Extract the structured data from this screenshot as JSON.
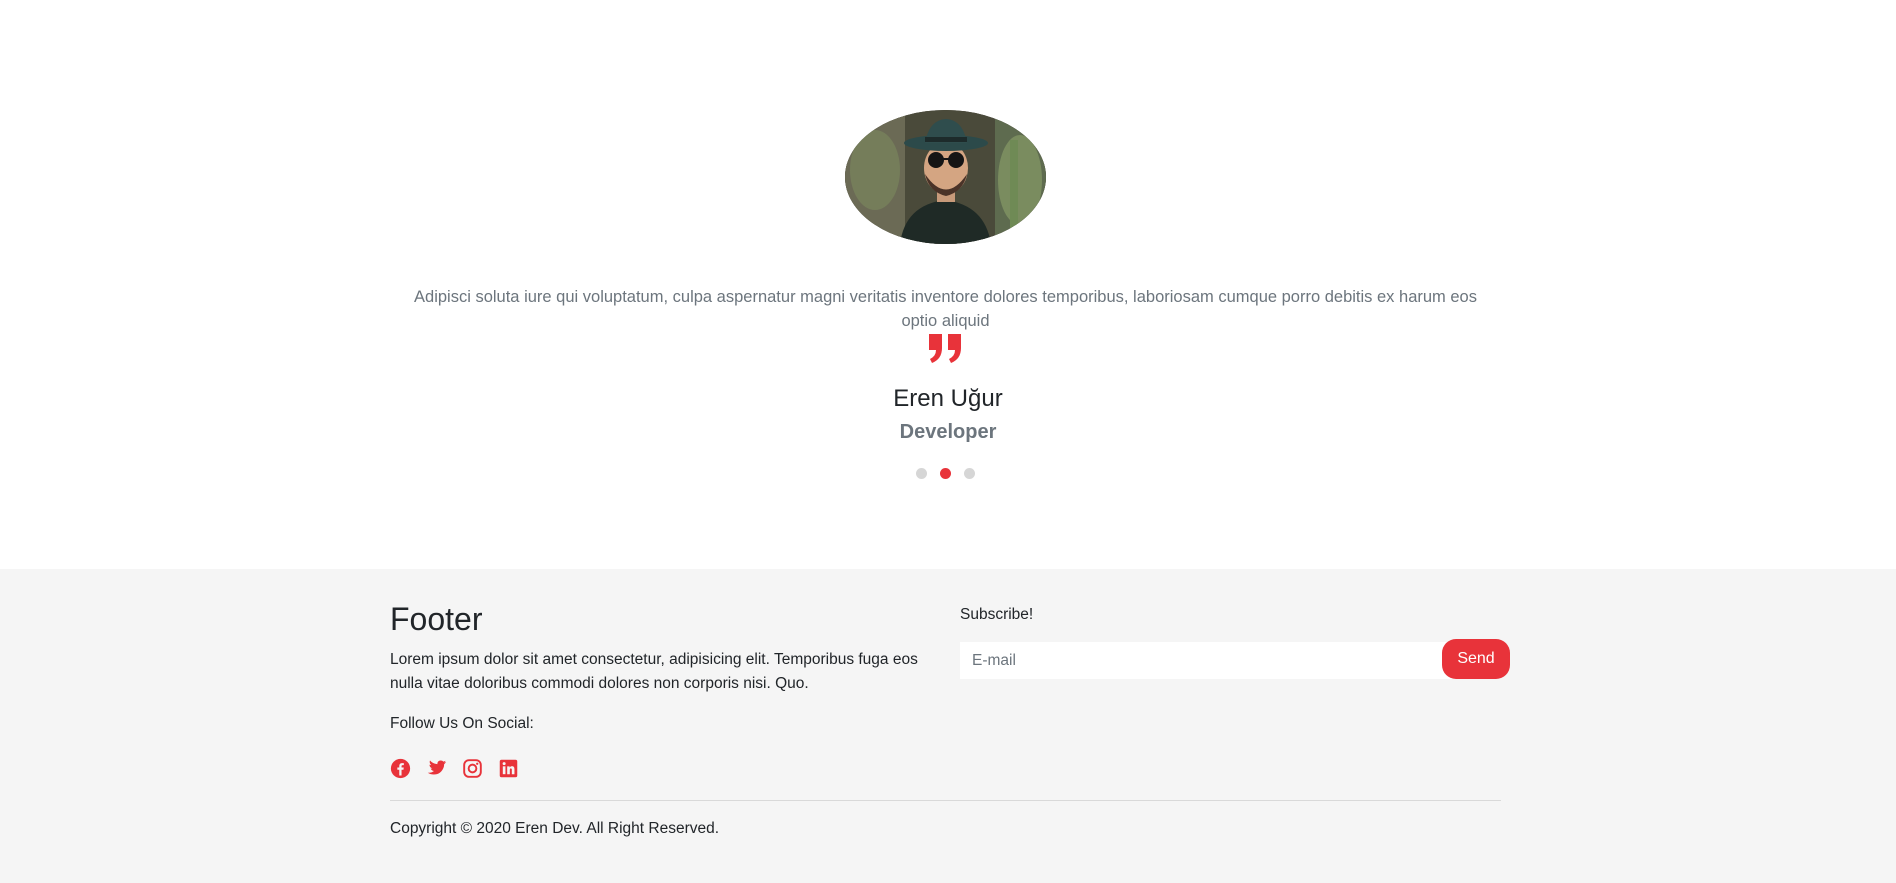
{
  "testimonial": {
    "quote": "Adipisci soluta iure qui voluptatum, culpa aspernatur magni veritatis inventore dolores temporibus, laboriosam cumque porro debitis ex harum eos optio aliquid",
    "name": "Eren Uğur",
    "role": "Developer",
    "slides": {
      "count": 3,
      "active_index": 1
    }
  },
  "footer": {
    "title": "Footer",
    "description": "Lorem ipsum dolor sit amet consectetur, adipisicing elit. Temporibus fuga eos nulla vitae doloribus commodi dolores non corporis nisi. Quo.",
    "follow_label": "Follow Us On Social:",
    "social_icons": [
      "facebook-icon",
      "twitter-icon",
      "instagram-icon",
      "linkedin-icon"
    ],
    "subscribe_label": "Subscribe!",
    "email_placeholder": "E-mail",
    "send_label": "Send",
    "copyright": "Copyright © 2020 Eren Dev. All Right Reserved."
  },
  "colors": {
    "accent": "#e8333a",
    "muted_text": "#6c757d",
    "footer_bg": "#f5f5f5",
    "dot_inactive": "#d6d6d6"
  }
}
